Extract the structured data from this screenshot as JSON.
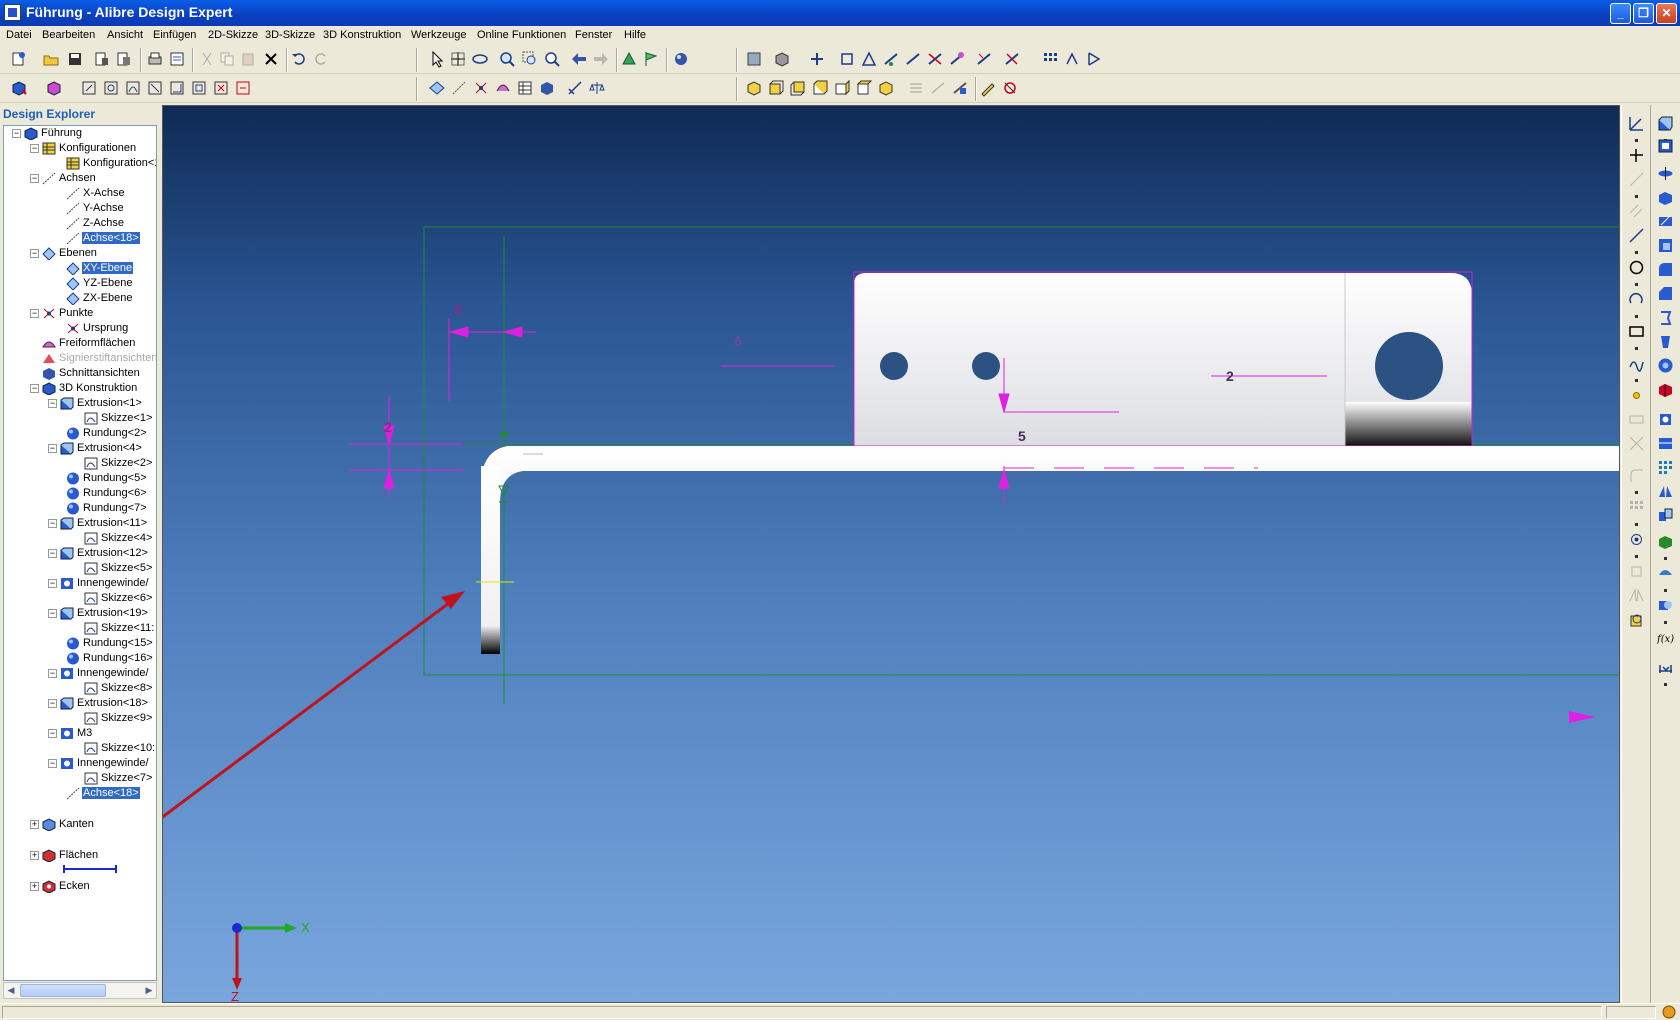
{
  "window": {
    "title": "Führung - Alibre Design Expert",
    "minimize": "_",
    "maximize": "❐",
    "close": "✕"
  },
  "menu": [
    {
      "label": "Datei"
    },
    {
      "label": "Bearbeiten"
    },
    {
      "label": "Ansicht"
    },
    {
      "label": "Einfügen"
    },
    {
      "label": "2D-Skizze"
    },
    {
      "label": "3D-Skizze"
    },
    {
      "label": "3D Konstruktion"
    },
    {
      "label": "Werkzeuge"
    },
    {
      "label": "Online Funktionen"
    },
    {
      "label": "Fenster"
    },
    {
      "label": "Hilfe"
    }
  ],
  "explorer": {
    "header": "Design Explorer",
    "nodes": [
      {
        "label": "Führung",
        "icon": "part-icon"
      },
      {
        "label": "Konfigurationen",
        "icon": "table-icon"
      },
      {
        "label": "Konfiguration<1",
        "icon": "table-icon"
      },
      {
        "label": "Achsen",
        "icon": "axis-icon"
      },
      {
        "label": "X-Achse",
        "icon": "axis-icon"
      },
      {
        "label": "Y-Achse",
        "icon": "axis-icon"
      },
      {
        "label": "Z-Achse",
        "icon": "axis-icon"
      },
      {
        "label": "Achse<18>",
        "icon": "axis-icon"
      },
      {
        "label": "Ebenen",
        "icon": "plane-icon"
      },
      {
        "label": "XY-Ebene",
        "icon": "plane-icon"
      },
      {
        "label": "YZ-Ebene",
        "icon": "plane-icon"
      },
      {
        "label": "ZX-Ebene",
        "icon": "plane-icon"
      },
      {
        "label": "Punkte",
        "icon": "point-icon"
      },
      {
        "label": "Ursprung",
        "icon": "point-icon"
      },
      {
        "label": "Freiformflächen",
        "icon": "surface-icon"
      },
      {
        "label": "Signierstiftansichten",
        "icon": "marker-icon"
      },
      {
        "label": "Schnittansichten",
        "icon": "section-icon"
      },
      {
        "label": "3D Konstruktion",
        "icon": "feature-icon"
      },
      {
        "label": "Extrusion<1>",
        "icon": "extrude-icon"
      },
      {
        "label": "Skizze<1>",
        "icon": "sketch-icon"
      },
      {
        "label": "Rundung<2>",
        "icon": "fillet-icon"
      },
      {
        "label": "Extrusion<4>",
        "icon": "extrude-icon"
      },
      {
        "label": "Skizze<2>",
        "icon": "sketch-icon"
      },
      {
        "label": "Rundung<5>",
        "icon": "fillet-icon"
      },
      {
        "label": "Rundung<6>",
        "icon": "fillet-icon"
      },
      {
        "label": "Rundung<7>",
        "icon": "fillet-icon"
      },
      {
        "label": "Extrusion<11>",
        "icon": "extrude-icon"
      },
      {
        "label": "Skizze<4>",
        "icon": "sketch-icon"
      },
      {
        "label": "Extrusion<12>",
        "icon": "extrude-icon"
      },
      {
        "label": "Skizze<5>",
        "icon": "sketch-icon"
      },
      {
        "label": "Innengewinde/",
        "icon": "thread-icon"
      },
      {
        "label": "Skizze<6>",
        "icon": "sketch-icon"
      },
      {
        "label": "Extrusion<19>",
        "icon": "extrude-icon"
      },
      {
        "label": "Skizze<11:",
        "icon": "sketch-icon"
      },
      {
        "label": "Rundung<15>",
        "icon": "fillet-icon"
      },
      {
        "label": "Rundung<16>",
        "icon": "fillet-icon"
      },
      {
        "label": "Innengewinde/",
        "icon": "thread-icon"
      },
      {
        "label": "Skizze<8>",
        "icon": "sketch-icon"
      },
      {
        "label": "Extrusion<18>",
        "icon": "extrude-icon"
      },
      {
        "label": "Skizze<9>",
        "icon": "sketch-icon"
      },
      {
        "label": "M3",
        "icon": "thread-icon"
      },
      {
        "label": "Skizze<10:",
        "icon": "sketch-icon"
      },
      {
        "label": "Innengewinde/",
        "icon": "thread-icon"
      },
      {
        "label": "Skizze<7>",
        "icon": "sketch-icon"
      },
      {
        "label": "Achse<18>",
        "icon": "axis-icon"
      },
      {
        "label": "Kanten",
        "icon": "edges-icon"
      },
      {
        "label": "Flächen",
        "icon": "faces-icon"
      },
      {
        "label": "Ecken",
        "icon": "vertices-icon"
      }
    ]
  },
  "viewport": {
    "dimensions": {
      "top_left_width": "2",
      "left_thickness": "2",
      "hole_offset": "6",
      "right_label": "2",
      "center_height": "5"
    },
    "triad": {
      "x": "X",
      "z": "Z"
    }
  },
  "colors": {
    "dimension": "#e020e0",
    "sketch_green": "#1f8a3a",
    "arrow": "#c0141c",
    "selection": "#316ac5"
  }
}
